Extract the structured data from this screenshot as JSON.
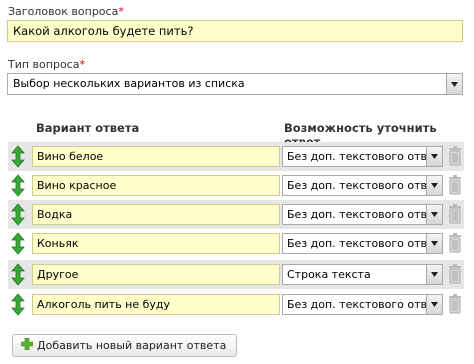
{
  "form": {
    "title_label": "Заголовок вопроса",
    "title_required": "*",
    "title_value": "Какой алкоголь будете пить?",
    "type_label": "Тип вопроса",
    "type_required": "*",
    "type_value": "Выбор нескольких вариантов из списка"
  },
  "answers_table": {
    "col_answer": "Вариант ответа",
    "col_clarify": "Возможность уточнить ответ",
    "rows": [
      {
        "answer": "Вино белое",
        "clarify": "Без доп. текстового ответа"
      },
      {
        "answer": "Вино красное",
        "clarify": "Без доп. текстового ответа"
      },
      {
        "answer": "Водка",
        "clarify": "Без доп. текстового ответа"
      },
      {
        "answer": "Коньяк",
        "clarify": "Без доп. текстового ответа"
      },
      {
        "answer": "Другое",
        "clarify": "Строка текста"
      },
      {
        "answer": "Алкоголь пить не буду",
        "clarify": "Без доп. текстового ответа"
      }
    ]
  },
  "add_button_label": "Добавить новый вариант ответа",
  "icons": {
    "drag": "drag-handle-icon",
    "delete": "trash-icon",
    "add": "plus-icon",
    "dropdown": "chevron-down-icon"
  },
  "colors": {
    "input_bg": "#ffffcc",
    "drag_green": "#3aa53a",
    "add_green": "#5bb030",
    "required_red": "#dd0000"
  }
}
